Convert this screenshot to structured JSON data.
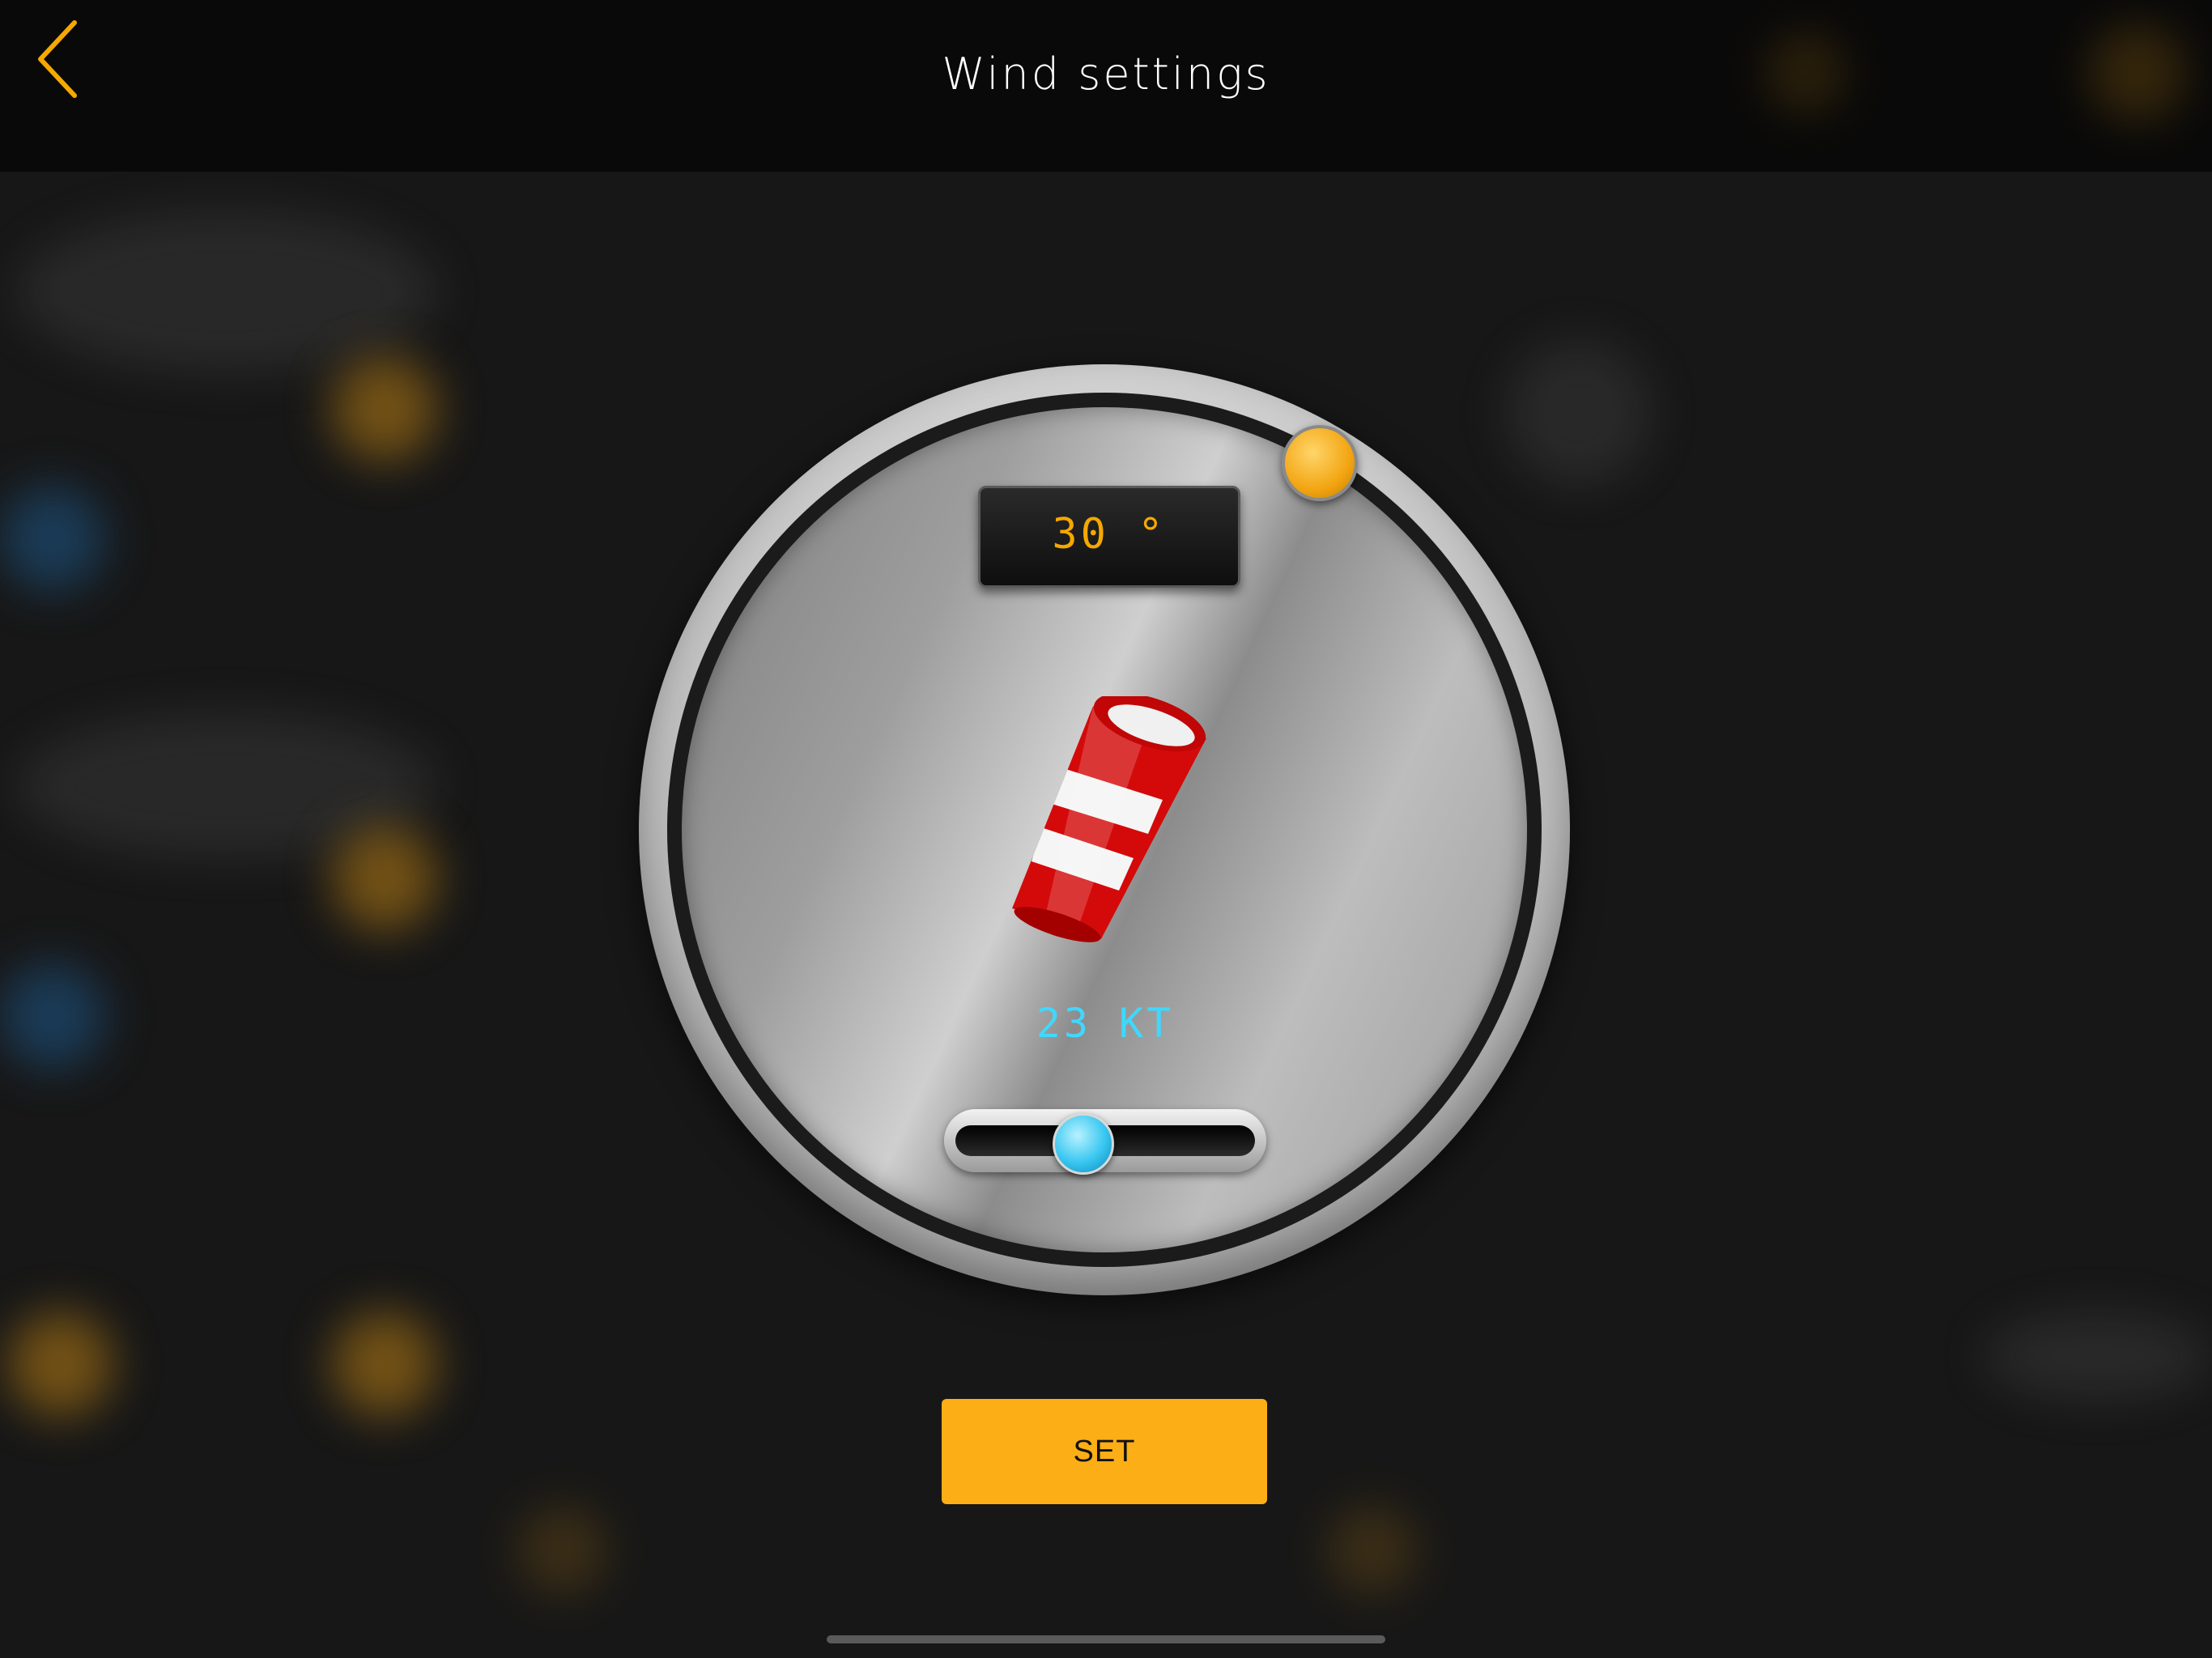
{
  "header": {
    "title": "Wind settings",
    "back_icon": "chevron-left-icon"
  },
  "wind": {
    "direction_readout": "30 °",
    "speed_readout": "23 KT",
    "speed_slider_fraction": 0.4
  },
  "actions": {
    "set_label": "SET"
  },
  "colors": {
    "accent_orange": "#fcae16",
    "speed_cyan": "#3fd8ff",
    "angle_amber": "#f5a800"
  }
}
